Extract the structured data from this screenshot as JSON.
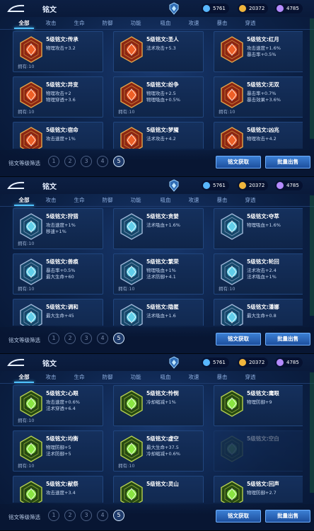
{
  "title": "铭文",
  "currencies": [
    {
      "name": "diamond-icon",
      "value": "5761",
      "color": "#58b7ff"
    },
    {
      "name": "gold-coin-icon",
      "value": "20372",
      "color": "#f0b53c"
    },
    {
      "name": "gem-icon",
      "value": "4785",
      "color": "#b58bff"
    }
  ],
  "tabs": [
    "全部",
    "攻击",
    "生命",
    "防御",
    "功能",
    "吸血",
    "攻速",
    "暴击",
    "穿透"
  ],
  "filter_label": "铭文等级筛选",
  "levels": [
    "1",
    "2",
    "3",
    "4",
    "5"
  ],
  "selected_level": "5",
  "buttons": {
    "get": "铭文获取",
    "sell": "批量出售"
  },
  "panels": [
    {
      "color": "red",
      "cards": [
        {
          "name": "5级铭文:传承",
          "s1": "物理攻击+3.2",
          "s2": "",
          "own": "拥有:10"
        },
        {
          "name": "5级铭文:圣人",
          "s1": "法术攻击+5.3",
          "s2": "",
          "own": ""
        },
        {
          "name": "5级铭文:红月",
          "s1": "攻击速度+1.6%",
          "s2": "暴击率+0.5%",
          "own": ""
        },
        {
          "name": "5级铭文:异变",
          "s1": "物理攻击+2",
          "s2": "物理穿透+3.6",
          "own": "拥有:10"
        },
        {
          "name": "5级铭文:纷争",
          "s1": "物理攻击+2.5",
          "s2": "物理吸血+0.5%",
          "own": "拥有:10"
        },
        {
          "name": "5级铭文:无双",
          "s1": "暴击率+0.7%",
          "s2": "暴击效果+3.6%",
          "own": "拥有:10"
        },
        {
          "name": "5级铭文:宿命",
          "s1": "攻击速度+1%",
          "s2": "",
          "own": ""
        },
        {
          "name": "5级铭文:梦魇",
          "s1": "法术攻击+4.2",
          "s2": "",
          "own": ""
        },
        {
          "name": "5级铭文:凶兆",
          "s1": "物理攻击+4.2",
          "s2": "",
          "own": ""
        }
      ]
    },
    {
      "color": "blue",
      "cards": [
        {
          "name": "5级铭文:狩猎",
          "s1": "攻击速度+1%",
          "s2": "移速+1%",
          "own": "拥有:10"
        },
        {
          "name": "5级铭文:贪婪",
          "s1": "法术吸血+1.6%",
          "s2": "",
          "own": ""
        },
        {
          "name": "5级铭文:夺萃",
          "s1": "物理吸血+1.6%",
          "s2": "",
          "own": ""
        },
        {
          "name": "5级铭文:兽痕",
          "s1": "暴击率+0.5%",
          "s2": "最大生命+60",
          "own": "拥有:10"
        },
        {
          "name": "5级铭文:繁荣",
          "s1": "物理吸血+1%",
          "s2": "法术防御+4.1",
          "own": "拥有:10"
        },
        {
          "name": "5级铭文:轮回",
          "s1": "法术攻击+2.4",
          "s2": "法术吸血+1%",
          "own": "拥有:10"
        },
        {
          "name": "5级铭文:调和",
          "s1": "最大生命+45",
          "s2": "",
          "own": ""
        },
        {
          "name": "5级铭文:隐匿",
          "s1": "法术吸血+1.6",
          "s2": "",
          "own": ""
        },
        {
          "name": "5级铭文:潘娜",
          "s1": "最大生命+0.8",
          "s2": "",
          "own": ""
        }
      ]
    },
    {
      "color": "green",
      "cards": [
        {
          "name": "5级铭文:心眼",
          "s1": "攻击速度+0.6%",
          "s2": "法术穿透+6.4",
          "own": "拥有:10"
        },
        {
          "name": "5级铭文:怜悯",
          "s1": "冷却缩减+1%",
          "s2": "",
          "own": ""
        },
        {
          "name": "5级铭文:鹰眼",
          "s1": "物理防御+9",
          "s2": "",
          "own": ""
        },
        {
          "name": "5级铭文:均衡",
          "s1": "物理防御+5",
          "s2": "法术防御+5",
          "own": "拥有:10"
        },
        {
          "name": "5级铭文:虚空",
          "s1": "最大生命+37.5",
          "s2": "冷却缩减+0.6%",
          "own": "拥有:10"
        },
        {
          "name": "5级铭文:空白",
          "s1": "",
          "s2": "",
          "own": ""
        },
        {
          "name": "5级铭文:献祭",
          "s1": "攻击速度+3.4",
          "s2": "",
          "own": ""
        },
        {
          "name": "5级铭文:灵山",
          "s1": "",
          "s2": "",
          "own": ""
        },
        {
          "name": "5级铭文:回声",
          "s1": "物理防御+2.7",
          "s2": "",
          "own": ""
        }
      ]
    }
  ]
}
